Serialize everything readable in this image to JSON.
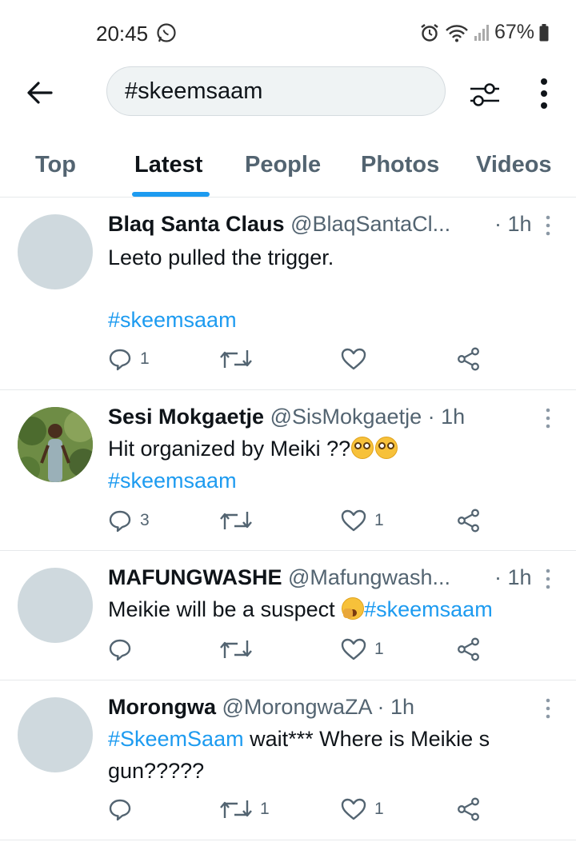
{
  "status": {
    "time": "20:45",
    "battery": "67%"
  },
  "search": {
    "query": "#skeemsaam"
  },
  "tabs": [
    "Top",
    "Latest",
    "People",
    "Photos",
    "Videos"
  ],
  "active_tab": "Latest",
  "colors": {
    "accent": "#1d9bf0",
    "secondary_text": "#536471",
    "avatar_placeholder": "#cfd9de"
  },
  "tweets": [
    {
      "name": "Blaq Santa Claus",
      "handle": "@BlaqSantaCl...",
      "time": "· 1h",
      "text": "Leeto pulled the trigger.",
      "hashtag": "#skeemsaam",
      "reply_count": "1",
      "retweet_count": "",
      "like_count": ""
    },
    {
      "name": "Sesi Mokgaetje",
      "handle": "@SisMokgaetje",
      "time": "· 1h",
      "text": "Hit organized by Meiki ??",
      "emoji": "flushed-face flushed-face",
      "hashtag": "#skeemsaam",
      "reply_count": "3",
      "retweet_count": "",
      "like_count": "1"
    },
    {
      "name": "MAFUNGWASHE",
      "handle": "@Mafungwash...",
      "time": "· 1h",
      "text": "Meikie will be a suspect ",
      "emoji": "yawning-face",
      "hashtag": "#skeemsaam",
      "reply_count": "",
      "retweet_count": "",
      "like_count": "1"
    },
    {
      "name": "Morongwa",
      "handle": "@MorongwaZA",
      "time": "· 1h",
      "hashtag": "#SkeemSaam",
      "text": " wait*** Where is Meikie s gun?????",
      "reply_count": "",
      "retweet_count": "1",
      "like_count": "1"
    }
  ]
}
